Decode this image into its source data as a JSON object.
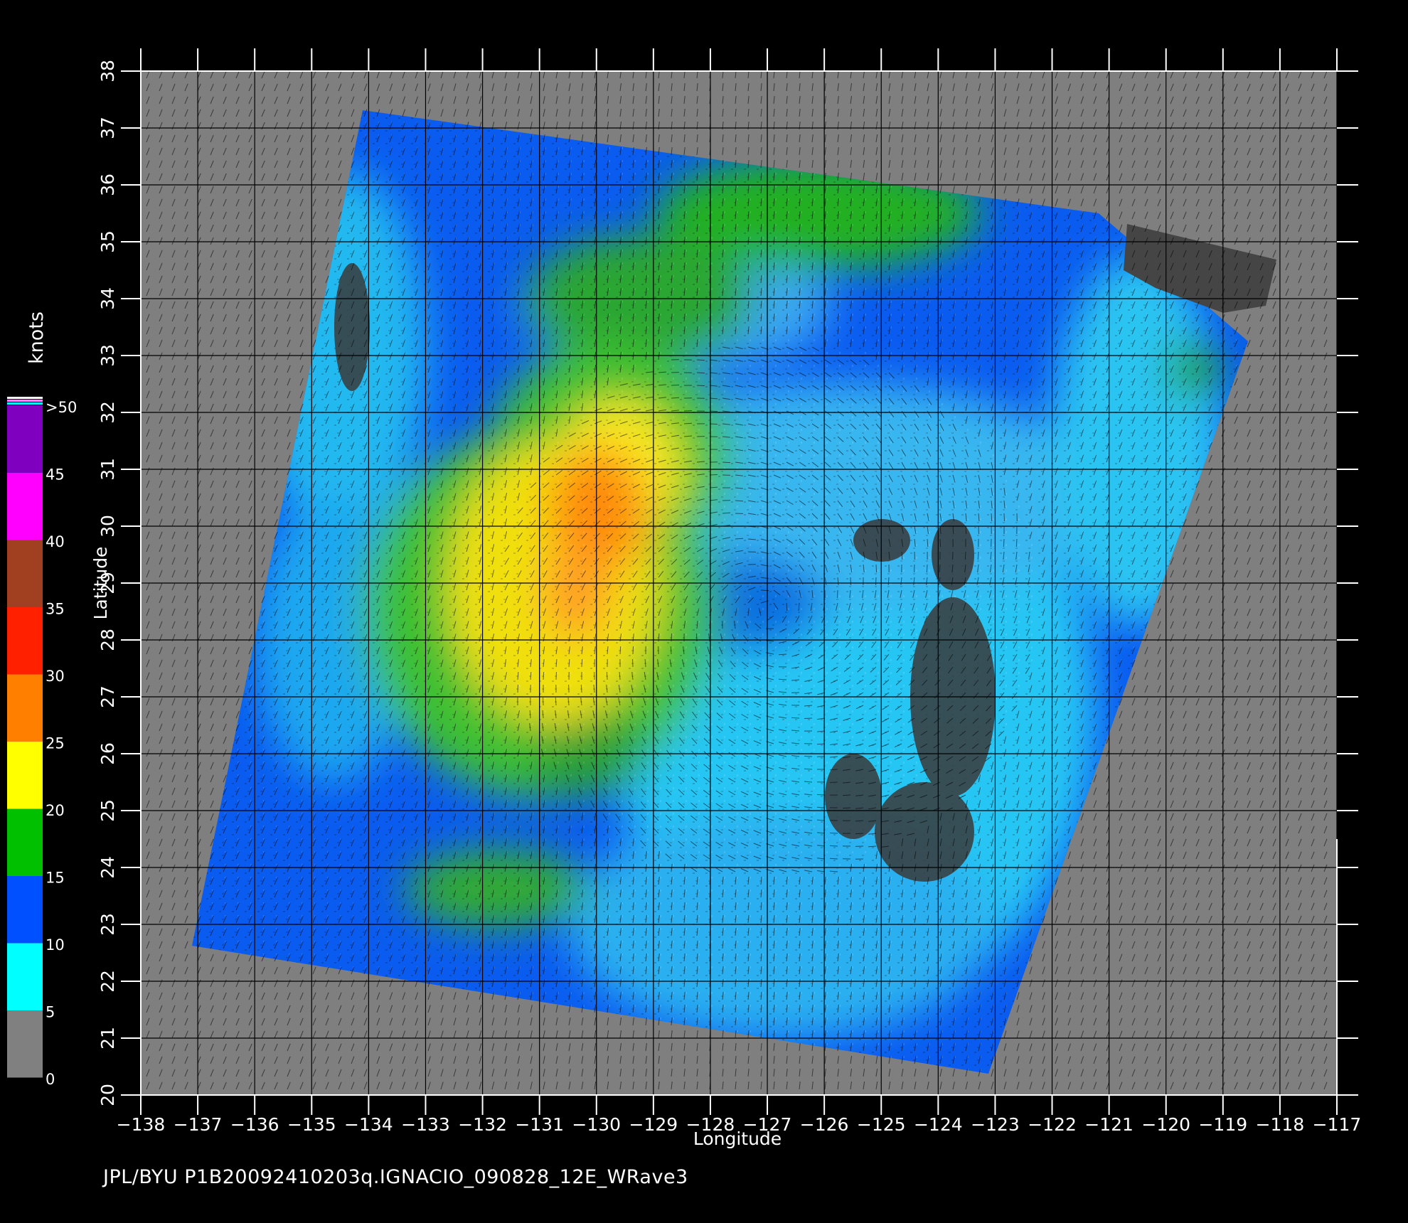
{
  "map": {
    "x_axis": {
      "label": "Longitude",
      "min": -138,
      "max": -117,
      "ticks": [
        "−138",
        "−137",
        "−136",
        "−135",
        "−134",
        "−133",
        "−132",
        "−131",
        "−130",
        "−129",
        "−128",
        "−127",
        "−126",
        "−125",
        "−124",
        "−123",
        "−122",
        "−121",
        "−120",
        "−119",
        "−118",
        "−117"
      ]
    },
    "y_axis": {
      "label": "Latitude",
      "min": 20,
      "max": 38,
      "ticks": [
        "20",
        "21",
        "22",
        "23",
        "24",
        "25",
        "26",
        "27",
        "28",
        "29",
        "30",
        "31",
        "32",
        "33",
        "34",
        "35",
        "36",
        "37",
        "38"
      ]
    },
    "colorbar": {
      "unit": "knots",
      "labels": [
        "0",
        "5",
        "10",
        "15",
        "20",
        "25",
        "30",
        "35",
        "40",
        "45",
        ">50"
      ],
      "colors": [
        "#808080",
        "#00ffff",
        "#0050ff",
        "#00c000",
        "#ffff00",
        "#ff8000",
        "#ff2000",
        "#a04020",
        "#ff00ff",
        "#8000c0"
      ]
    },
    "colors": {
      "background": "#000000",
      "land_nodata": "#7f7f7f",
      "rain_flag": "#3a3a3a",
      "grid": "#000000"
    },
    "cyclone_center": {
      "lon": -127,
      "lat": 28.5
    }
  },
  "footer": {
    "caption": "JPL/BYU  P1B20092410203q.IGNACIO_090828_12E_WRave3"
  }
}
